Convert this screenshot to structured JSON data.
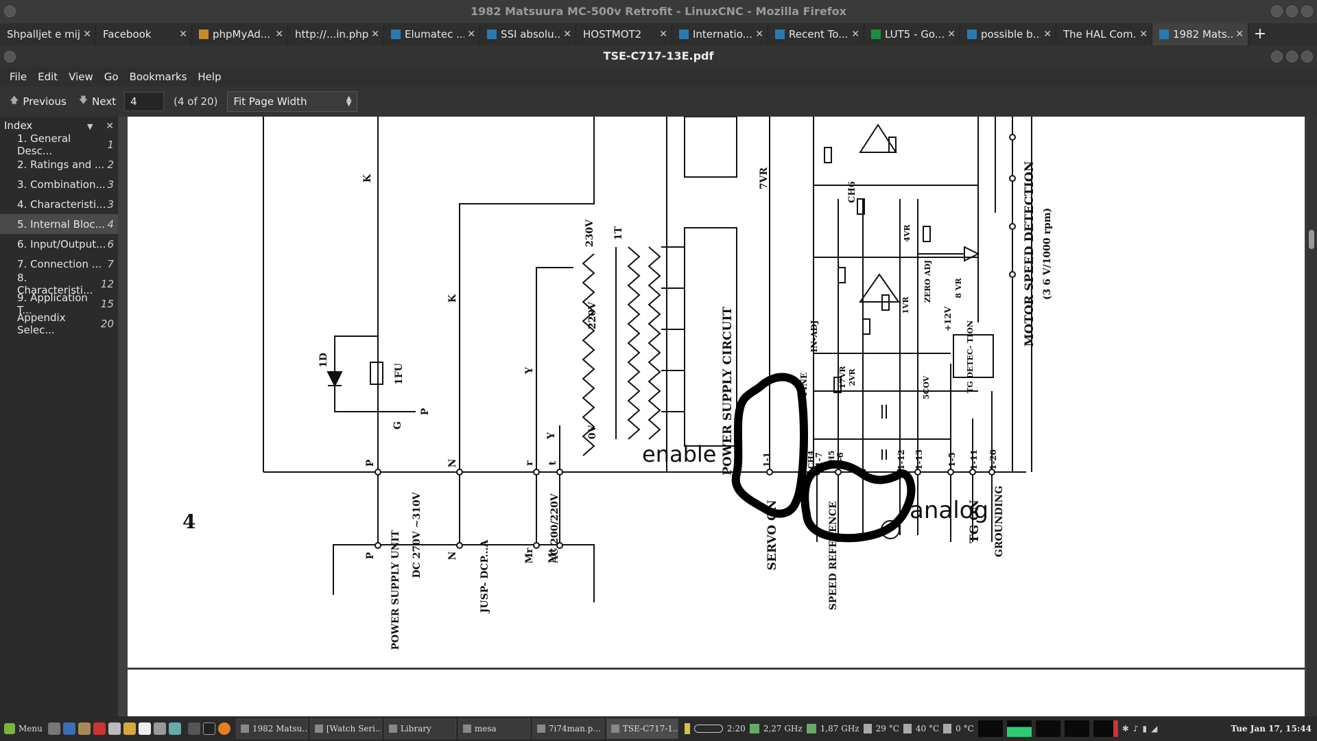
{
  "window": {
    "title": "1982 Matsuura MC-500v Retrofit - LinuxCNC - Mozilla Firefox"
  },
  "tabs": [
    {
      "label": "Shpalljet e mija"
    },
    {
      "label": "Facebook"
    },
    {
      "label": "phpMyAd..."
    },
    {
      "label": "http://...in.php"
    },
    {
      "label": "Elumatec ..."
    },
    {
      "label": "SSI absolu..."
    },
    {
      "label": "HOSTMOT2"
    },
    {
      "label": "Internatio..."
    },
    {
      "label": "Recent To..."
    },
    {
      "label": "LUT5 - Go..."
    },
    {
      "label": "possible b..."
    },
    {
      "label": "The HAL Com..."
    },
    {
      "label": "1982 Mats..."
    }
  ],
  "viewer": {
    "title": "TSE-C717-13E.pdf"
  },
  "menu": [
    "File",
    "Edit",
    "View",
    "Go",
    "Bookmarks",
    "Help"
  ],
  "toolbar": {
    "previous": "Previous",
    "next": "Next",
    "page": "4",
    "page_of": "(4 of 20)",
    "zoom": "Fit Page Width"
  },
  "sidebar": {
    "title": "Index",
    "items": [
      {
        "label": "1. General Desc...",
        "page": "1"
      },
      {
        "label": "2. Ratings and ...",
        "page": "2"
      },
      {
        "label": "3. Combination...",
        "page": "3"
      },
      {
        "label": "4. Characteristi...",
        "page": "3"
      },
      {
        "label": "5. Internal Bloc...",
        "page": "4"
      },
      {
        "label": "6. Input/Output...",
        "page": "6"
      },
      {
        "label": "7. Connection ...",
        "page": "7"
      },
      {
        "label": "8. Characteristi...",
        "page": "12"
      },
      {
        "label": "9. Application T...",
        "page": "15"
      },
      {
        "label": "Appendix Selec...",
        "page": "20"
      }
    ]
  },
  "schematic": {
    "page_number": "4",
    "annot_enable": "enable",
    "annot_analog": "analog",
    "labels": {
      "power_supply_circuit": "POWER SUPPLY CIRCUIT",
      "motor_speed": "MOTOR SPEED DETECTION",
      "rpm": "(3 6 V/1000 rpm)",
      "servo_on": "SERVO ON",
      "speed_ref": "SPEED REFERENCE",
      "tg_on": "TG ON",
      "grounding": "GROUNDING",
      "power_supply_unit": "POWER SUPPLY UNIT",
      "dc_range": "DC 270V ~310V",
      "ac_range": "AC 200/220V",
      "jusp": "JUSP- DCP...A",
      "v230": "230V",
      "v220": "220V",
      "v0": "0V",
      "t1": "1T",
      "fu1": "1FU",
      "d1": "1D",
      "vr7": "7VR",
      "ch6": "CH6",
      "ch4": "CH4",
      "ch5": "CH5",
      "fine": "FINE",
      "in_adj": "IN-ADJ",
      "tg_detection": "TG DETEC- TION",
      "plus12v": "+12V",
      "zero_adj": "ZERO ADJ",
      "vr8": "8 VR",
      "vr4": "4VR",
      "vr1": "1VR",
      "vr2": "2VR",
      "vr17": "17VR",
      "scov": "5COV",
      "pin_1_1": "1-1",
      "pin_1_7": "1-7",
      "pin_1_6": "1-6",
      "pin_1_12": "1-12",
      "pin_1_13": "1-13",
      "pin_1_5": "1-5",
      "pin_1_11": "1-11",
      "pin_1_20": "1-20",
      "k": "K",
      "p": "P",
      "n": "N",
      "g": "G",
      "y": "Y",
      "r": "r",
      "t": "t",
      "mr": "Mr",
      "mt": "Mt"
    }
  },
  "taskbar": {
    "menu": "Menu",
    "windows": [
      "1982 Matsu...",
      "[Watch Seri...",
      "Library",
      "mesa",
      "7i74man.p...",
      "TSE-C717-1..."
    ],
    "battery_time": "2:20",
    "mem": "2,27 GHz",
    "cpu_freq": "1,87 GHz",
    "temp1": "29 °C",
    "temp2": "40 °C",
    "temp3": "0 °C",
    "clock": "Tue Jan 17, 15:44"
  }
}
